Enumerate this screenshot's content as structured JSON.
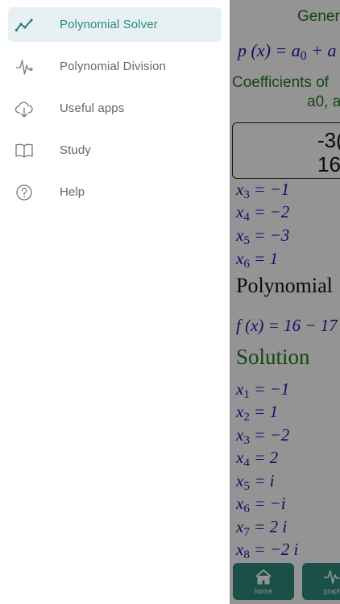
{
  "drawer": {
    "items": [
      {
        "label": "Polynomial Solver",
        "icon": "trend-chart-icon",
        "active": true
      },
      {
        "label": "Polynomial Division",
        "icon": "pulse-wave-icon",
        "active": false
      },
      {
        "label": "Useful apps",
        "icon": "cloud-download-icon",
        "active": false
      },
      {
        "label": "Study",
        "icon": "open-book-icon",
        "active": false
      },
      {
        "label": "Help",
        "icon": "help-circle-icon",
        "active": false
      }
    ]
  },
  "main": {
    "general_title": "Gener",
    "polynomial_definition": "p (x) = a0 + a",
    "coefficients_label": "Coefficients of",
    "coefficients_sublabel": "a0, a",
    "coefficients_input": {
      "line1": "-3(",
      "line2": "16,"
    },
    "previous_roots": [
      {
        "var": "x",
        "sub": "3",
        "value": "−1"
      },
      {
        "var": "x",
        "sub": "4",
        "value": "−2"
      },
      {
        "var": "x",
        "sub": "5",
        "value": "−3"
      },
      {
        "var": "x",
        "sub": "6",
        "value": "1"
      }
    ],
    "polynomial_heading": "Polynomial",
    "polynomial_expression": "f (x) = 16 − 17",
    "solution_heading": "Solution",
    "solution_roots": [
      {
        "var": "x",
        "sub": "1",
        "value": "−1"
      },
      {
        "var": "x",
        "sub": "2",
        "value": "1"
      },
      {
        "var": "x",
        "sub": "3",
        "value": "−2"
      },
      {
        "var": "x",
        "sub": "4",
        "value": "2"
      },
      {
        "var": "x",
        "sub": "5",
        "value": "i"
      },
      {
        "var": "x",
        "sub": "6",
        "value": "−i"
      },
      {
        "var": "x",
        "sub": "7",
        "value": "2 i"
      },
      {
        "var": "x",
        "sub": "8",
        "value": "−2 i"
      }
    ],
    "tabs": [
      {
        "label": "home",
        "icon": "home-icon"
      },
      {
        "label": "graph",
        "icon": "pulse-wave-icon"
      }
    ]
  },
  "colors": {
    "accent": "#2a8a80",
    "active_background": "#e7f1f3",
    "math_blue": "#1a1ab0",
    "heading_green": "#1f7a1f",
    "tab_background": "#2e8b7b"
  }
}
